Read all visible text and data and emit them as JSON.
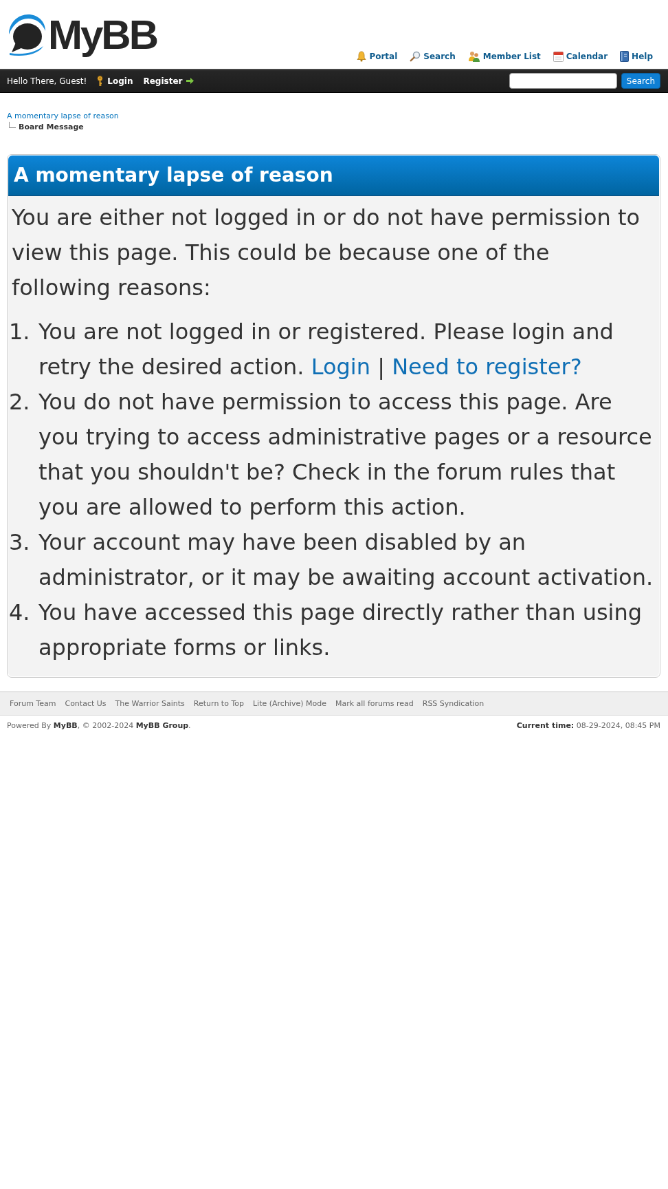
{
  "header": {
    "logo": {
      "text": "MyBB"
    },
    "nav": [
      {
        "label": "Portal",
        "kind": "portal"
      },
      {
        "label": "Search",
        "kind": "search"
      },
      {
        "label": "Member List",
        "kind": "members"
      },
      {
        "label": "Calendar",
        "kind": "calendar"
      },
      {
        "label": "Help",
        "kind": "help"
      }
    ]
  },
  "panel": {
    "greeting": "Hello There, Guest!",
    "links": [
      {
        "label": "Login",
        "kind": "login"
      },
      {
        "label": "Register",
        "kind": "register"
      }
    ],
    "search": {
      "button": "Search"
    }
  },
  "breadcrumb": {
    "parent": "A momentary lapse of reason",
    "current": "Board Message"
  },
  "message": {
    "title": "A momentary lapse of reason",
    "intro": "You are either not logged in or do not have permission to view this page. This could be because one of the following reasons:",
    "reasons": [
      {
        "number": "1.",
        "text": "You are not logged in or registered. Please login and retry the desired action.",
        "links": [
          "Login",
          "Need to register?"
        ],
        "separator": "|"
      },
      {
        "number": "2.",
        "text": "You do not have permission to access this page. Are you trying to access administrative pages or a resource that you shouldn't be? Check in the forum rules that you are allowed to perform this action."
      },
      {
        "number": "3.",
        "text": "Your account may have been disabled by an administrator, or it may be awaiting account activation."
      },
      {
        "number": "4.",
        "text": "You have accessed this page directly rather than using appropriate forms or links."
      }
    ]
  },
  "footer": {
    "links": [
      "Forum Team",
      "Contact Us",
      "The Warrior Saints",
      "Return to Top",
      "Lite (Archive) Mode",
      "Mark all forums read",
      "RSS Syndication"
    ],
    "powered_by": "Powered By **MyBB**, © 2002-2024 **MyBB Group**.",
    "current_time": "**Current time:** 08-29-2024, 08:45 PM"
  }
}
